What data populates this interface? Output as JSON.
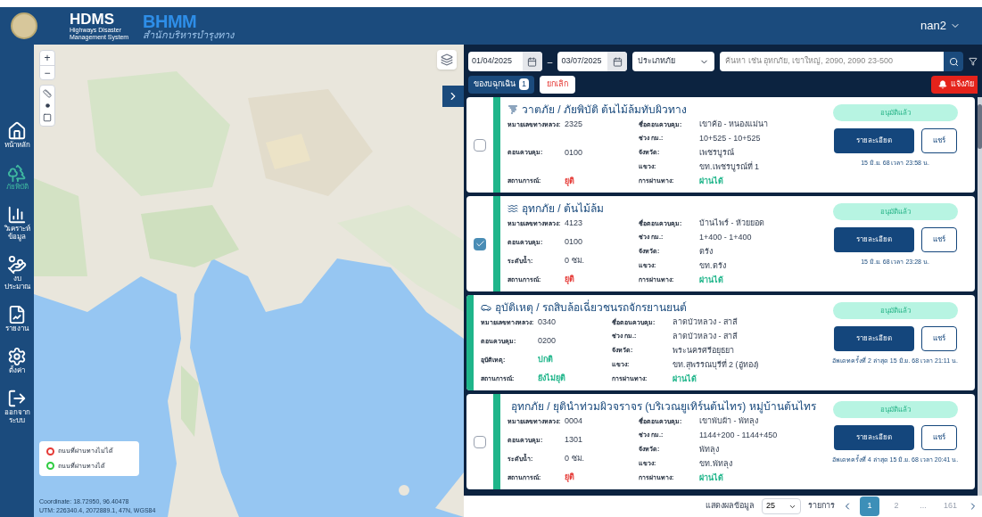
{
  "header": {
    "logo_title": "HDMS",
    "logo_subtitle": "Highways Disaster Management System",
    "brand": "BHMM",
    "brand_thai": "สำนักบริหารบำรุงทาง",
    "user": "nan2"
  },
  "sidebar": {
    "items": [
      {
        "label": "หน้าหลัก",
        "selected": false
      },
      {
        "label": "ภัยพิบัติ",
        "selected": true
      },
      {
        "label": "วิเคราะห์ ข้อมูล",
        "selected": false
      },
      {
        "label": "งบ ประมาณ",
        "selected": false
      },
      {
        "label": "รายงาน",
        "selected": false
      },
      {
        "label": "ตั้งค่า",
        "selected": false
      },
      {
        "label": "ออกจาก ระบบ",
        "selected": false
      }
    ]
  },
  "map": {
    "zoom_in": "+",
    "zoom_out": "−",
    "legend": [
      {
        "label": "ถนนที่ผ่านทางไม่ได้",
        "color": "#e53935"
      },
      {
        "label": "ถนนที่ผ่านทางได้",
        "color": "#2ecc40"
      }
    ],
    "coordinate": "Coordinate: 18.72950, 96.40478",
    "utm": "UTM: 226340.4, 2072889.1, 47N, WGS84"
  },
  "filters": {
    "date_from": "01/04/2025",
    "separator": "–",
    "date_to": "03/07/2025",
    "type_select": "ประเภทภัย",
    "search_placeholder": "ค้นหา เช่น อุทกภัย, เขาใหญ่, 2090, 2090 23-500"
  },
  "actions": {
    "emergency": "ของบฉุกเฉิน",
    "emergency_count": "1",
    "cancel": "ยกเลิก",
    "report": "แจ้งภัย"
  },
  "cards": [
    {
      "kind": "windstorm",
      "title": "วาตภัย / ภัยพิบัติ ต้นไม้ล้มทับผิวทาง",
      "checked": false,
      "status": "อนุมัติแล้ว",
      "detail": "รายละเอียด",
      "share": "แชร์",
      "timestamp": "15 มิ.ย. 68 เวลา 23:58 น.",
      "left": [
        {
          "label": "หมายเลขทางหลวง:",
          "value": "2325"
        },
        {
          "label": "ตอนควบคุม:",
          "value": "0100"
        },
        {
          "label": "สถานการณ์:",
          "value": "ยุติ",
          "color": "#e53935"
        }
      ],
      "right": [
        {
          "label": "ชื่อตอนควบคุม:",
          "value": "เขาค้อ - หนองแม่นา"
        },
        {
          "label": "ช่วง กม.:",
          "value": "10+525 - 10+525"
        },
        {
          "label": "จังหวัด:",
          "value": "เพชรบูรณ์"
        },
        {
          "label": "แขวง:",
          "value": "ขท.เพชรบูรณ์ที่ 1"
        },
        {
          "label": "การผ่านทาง:",
          "value": "ผ่านได้",
          "color": "#1fb58a"
        }
      ]
    },
    {
      "kind": "flood",
      "title": "อุทกภัย / ต้นไม้ล้ม",
      "checked": true,
      "status": "อนุมัติแล้ว",
      "detail": "รายละเอียด",
      "share": "แชร์",
      "timestamp": "15 มิ.ย. 68 เวลา 23:28 น.",
      "left": [
        {
          "label": "หมายเลขทางหลวง:",
          "value": "4123"
        },
        {
          "label": "ตอนควบคุม:",
          "value": "0100"
        },
        {
          "label": "ระดับน้ำ:",
          "value": "0 ซม."
        },
        {
          "label": "สถานการณ์:",
          "value": "ยุติ",
          "color": "#e53935"
        }
      ],
      "right": [
        {
          "label": "ชื่อตอนควบคุม:",
          "value": "บ้านไพร์ - ห้วยยอด"
        },
        {
          "label": "ช่วง กม.:",
          "value": "1+400 - 1+400"
        },
        {
          "label": "จังหวัด:",
          "value": "ตรัง"
        },
        {
          "label": "แขวง:",
          "value": "ขท.ตรัง"
        },
        {
          "label": "การผ่านทาง:",
          "value": "ผ่านได้",
          "color": "#1fb58a"
        }
      ]
    },
    {
      "kind": "accident",
      "title": "อุบัติเหตุ / รถสิบล้อเฉี่ยวชนรถจักรยานยนต์",
      "status": "อนุมัติแล้ว",
      "detail": "รายละเอียด",
      "share": "แชร์",
      "timestamp": "อัพเดทครั้งที่ 2 ล่าสุด 15 มิ.ย. 68 เวลา 21:11 น.",
      "left": [
        {
          "label": "หมายเลขทางหลวง:",
          "value": "0340"
        },
        {
          "label": "ตอนควบคุม:",
          "value": "0200"
        },
        {
          "label": "อุบัติเหตุ:",
          "value": "ปกติ",
          "color": "#1fb58a"
        },
        {
          "label": "สถานการณ์:",
          "value": "ยังไม่ยุติ",
          "color": "#1fb58a"
        }
      ],
      "right": [
        {
          "label": "ชื่อตอนควบคุม:",
          "value": "ลาดบัวหลวง - สาลี"
        },
        {
          "label": "ช่วง กม.:",
          "value": "ลาดบัวหลวง - สาลี"
        },
        {
          "label": "จังหวัด:",
          "value": "พระนครศรีอยุธยา"
        },
        {
          "label": "แขวง:",
          "value": "ขท.สุพรรณบุรีที่ 2 (อู่ทอง)"
        },
        {
          "label": "การผ่านทาง:",
          "value": "ผ่านได้",
          "color": "#1fb58a"
        }
      ]
    },
    {
      "kind": "flood",
      "title": "อุทกภัย / ยุตินำท่วมผิวจราจร (บริเวณยูเทิร์นต้นไทร) หมู่บ้านต้นไทร",
      "checked": false,
      "status": "อนุมัติแล้ว",
      "detail": "รายละเอียด",
      "share": "แชร์",
      "timestamp": "อัพเดทครั้งที่ 4 ล่าสุด 15 มิ.ย. 68 เวลา 20:41 น.",
      "left": [
        {
          "label": "หมายเลขทางหลวง:",
          "value": "0004"
        },
        {
          "label": "ตอนควบคุม:",
          "value": "1301"
        },
        {
          "label": "ระดับน้ำ:",
          "value": "0 ซม."
        },
        {
          "label": "สถานการณ์:",
          "value": "ยุติ",
          "color": "#e53935"
        }
      ],
      "right": [
        {
          "label": "ชื่อตอนควบคุม:",
          "value": "เขาพับผ้า - พัทลุง"
        },
        {
          "label": "ช่วง กม.:",
          "value": "1144+200 - 1144+450"
        },
        {
          "label": "จังหวัด:",
          "value": "พัทลุง"
        },
        {
          "label": "แขวง:",
          "value": "ขท.พัทลุง"
        },
        {
          "label": "การผ่านทาง:",
          "value": "ผ่านได้",
          "color": "#1fb58a"
        }
      ]
    }
  ],
  "pagination": {
    "show_label": "แสดงผลข้อมูล",
    "page_size": "25",
    "unit": "รายการ",
    "pages": [
      {
        "label": "1",
        "selected": true
      },
      {
        "label": "2",
        "selected": false
      },
      {
        "label": "...",
        "selected": false
      },
      {
        "label": "161",
        "selected": false
      }
    ]
  }
}
